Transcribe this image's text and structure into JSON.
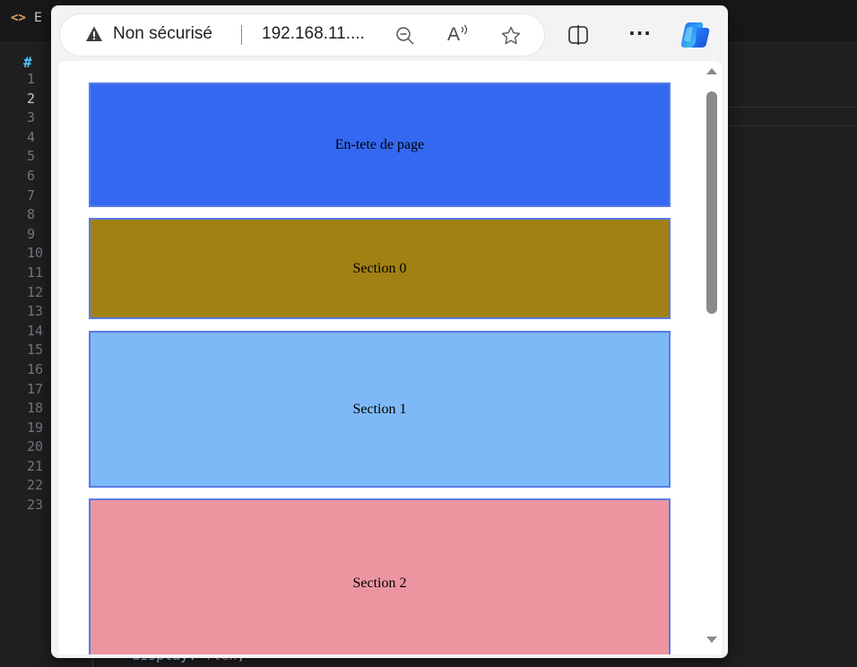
{
  "editor": {
    "tab_icon": "<>",
    "tab_label": "E",
    "breadcrumb_symbol": "#",
    "line_numbers": [
      "1",
      "2",
      "3",
      "4",
      "5",
      "6",
      "7",
      "8",
      "9",
      "10",
      "11",
      "12",
      "13",
      "14",
      "15",
      "16",
      "17",
      "18",
      "19",
      "20",
      "21",
      "22",
      "23"
    ],
    "active_line": "2",
    "code_line_23": {
      "property": "display",
      "punct": ":",
      "value": "flex",
      "end": ";"
    }
  },
  "browser": {
    "security_label": "Non sécurisé",
    "url": "192.168.11....",
    "icons": {
      "warning": "warning-triangle-icon",
      "zoom": "zoom-out-icon",
      "read_aloud": "read-aloud-icon",
      "favorite": "favorite-star-icon",
      "split": "split-screen-icon",
      "more": "more-icon",
      "copilot": "copilot-icon"
    },
    "read_aloud_glyph": "A",
    "more_glyph": "···"
  },
  "page": {
    "header": {
      "label": "En-tete de page",
      "color": "#3468f0"
    },
    "sections": [
      {
        "label": "Section 0",
        "color": "#a18113"
      },
      {
        "label": "Section 1",
        "color": "#7eb9f7"
      },
      {
        "label": "Section 2",
        "color": "#ec95a1"
      }
    ],
    "border_color": "#5a7be6"
  },
  "scrollbar": {
    "position": 0.0,
    "visible_fraction": 0.33
  }
}
